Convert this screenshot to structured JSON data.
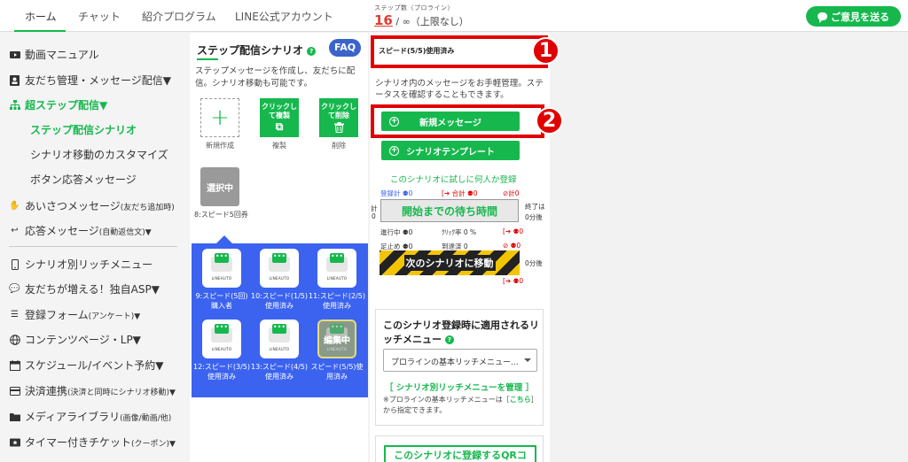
{
  "topnav": {
    "tabs": [
      "ホーム",
      "チャット",
      "紹介プログラム",
      "LINE公式アカウント"
    ],
    "steps_caption": "ステップ数（プロライン）",
    "steps_used": "16",
    "steps_rest": "/ ∞（上限なし）",
    "feedback": "ご意見を送る"
  },
  "sidebar": {
    "items": [
      "動画マニュアル",
      "友だち管理・メッセージ配信▼",
      "超ステップ配信▼",
      "ステップ配信シナリオ",
      "シナリオ移動のカスタマイズ",
      "ボタン応答メッセージ",
      "あいさつメッセージ",
      "(友だち追加時)",
      "応答メッセージ",
      "(自動返信文)▼",
      "シナリオ別リッチメニュー",
      "友だちが増える！独自ASP▼",
      "登録フォーム",
      "(アンケート)▼",
      "コンテンツページ・LP▼",
      "スケジュール/イベント予約▼",
      "決済連携",
      "(決済と同時にシナリオ移動)▼",
      "メディアライブラリ",
      "(画像/動画/他)",
      "タイマー付きチケット",
      "(クーポン)▼"
    ]
  },
  "scenario_panel": {
    "title": "ステップ配信シナリオ",
    "help": "?",
    "faq": "FAQ",
    "description": "ステップメッセージを作成し、友だちに配信。シナリオ移動も可能です。",
    "new_plus": "+",
    "new_caption": "新規作成",
    "copy_label": "クリックして複製",
    "copy_caption": "複製",
    "delete_label": "クリックして削除",
    "delete_caption": "削除",
    "selected_label": "選択中",
    "selected_caption": "8:スピード5回券",
    "tile_logo": "LINEAUTO",
    "tile_dots": "•••",
    "editing_label": "編集中",
    "scenarios": [
      "9:スピード(5回)購入者",
      "10:スピード(1/5)使用済み",
      "11:スピード(2/5)使用済み",
      "12:スピード(3/5)使用済み",
      "13:スピード(4/5)使用済み",
      "スピード(5/5)使用済み"
    ]
  },
  "detail": {
    "scenario_name": "スピード(5/5)使用済み",
    "badge1": "1",
    "badge2": "2",
    "description": "シナリオ内のメッセージをお手軽管理。ステータスを確認することもできます。",
    "new_message": "新規メッセージ",
    "template": "シナリオテンプレート",
    "plus": "+",
    "trial": "このシナリオに試しに何人か登録",
    "stats": {
      "reg_total": "登録計 ⚉0",
      "sum": "[➔ 合計 ⚉0",
      "ban_total": "⊘計0",
      "left_total": "計",
      "left_zero": "0",
      "wait_label": "開始までの待ち時間",
      "end_is": "終了は",
      "end_after": "0分後",
      "in_progress": "進行中 ⚉0",
      "click_rate": "ｸﾘｯｸ率 0 %",
      "exit1": "[➔ ⚉0",
      "stopped": "足止め ⚉0",
      "reached": "到達済 0",
      "ban2": "⊘ ⚉0",
      "next_scenario": "次のシナリオに移動",
      "next_after": "0分後",
      "exit2": "[➔ ⚉0"
    },
    "rich_title": "このシナリオ登録時に適用されるリッチメニュー",
    "rich_help": "?",
    "rich_select": "プロラインの基本リッチメニュー...",
    "rich_link": "［ シナリオ別リッチメニューを管理 ］",
    "rich_note_pre": "※プロラインの基本リッチメニューは［",
    "rich_note_link": "こちら",
    "rich_note_post": "］から指定できます。",
    "qr_button": "このシナリオに登録するQRコ"
  }
}
